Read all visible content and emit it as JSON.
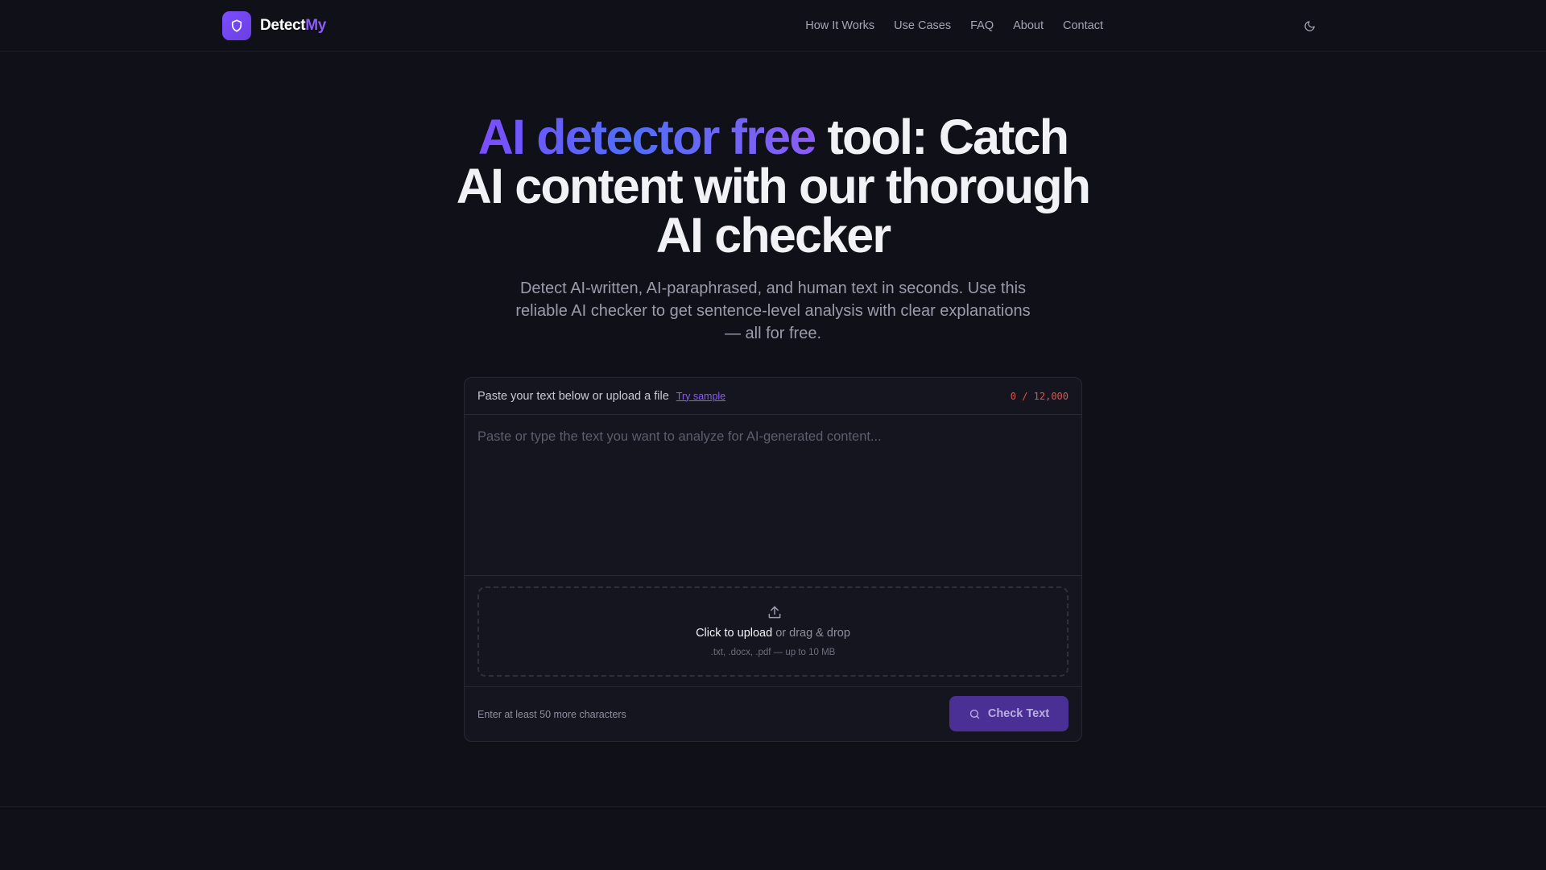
{
  "header": {
    "brand_part1": "Detect",
    "brand_part2": "My",
    "nav": [
      "How It Works",
      "Use Cases",
      "FAQ",
      "About",
      "Contact"
    ],
    "logo_icon": "shield-icon",
    "theme_icon": "moon-icon"
  },
  "hero": {
    "title_highlight": "AI detector free",
    "title_rest": " tool: Catch AI content with our thorough AI checker",
    "subtitle": "Detect AI-written, AI-paraphrased, and human text in seconds. Use this reliable AI checker to get sentence-level analysis with clear explanations — all for free."
  },
  "input": {
    "label": "Paste your text below or upload a file",
    "try_sample": "Try sample",
    "counter": "0 / 12,000",
    "placeholder": "Paste or type the text you want to analyze for AI-generated content..."
  },
  "upload": {
    "click_text": "Click to upload",
    "rest_text": " or drag & drop",
    "formats": ".txt, .docx, .pdf — up to 10 MB",
    "icon": "upload-icon"
  },
  "footer": {
    "hint": "Enter at least 50 more characters",
    "check_label": "Check Text",
    "check_icon": "search-icon"
  },
  "colors": {
    "accent": "#8b5cf6",
    "background": "#0f1018",
    "button": "#4a2f94",
    "counter": "#e0524f"
  }
}
